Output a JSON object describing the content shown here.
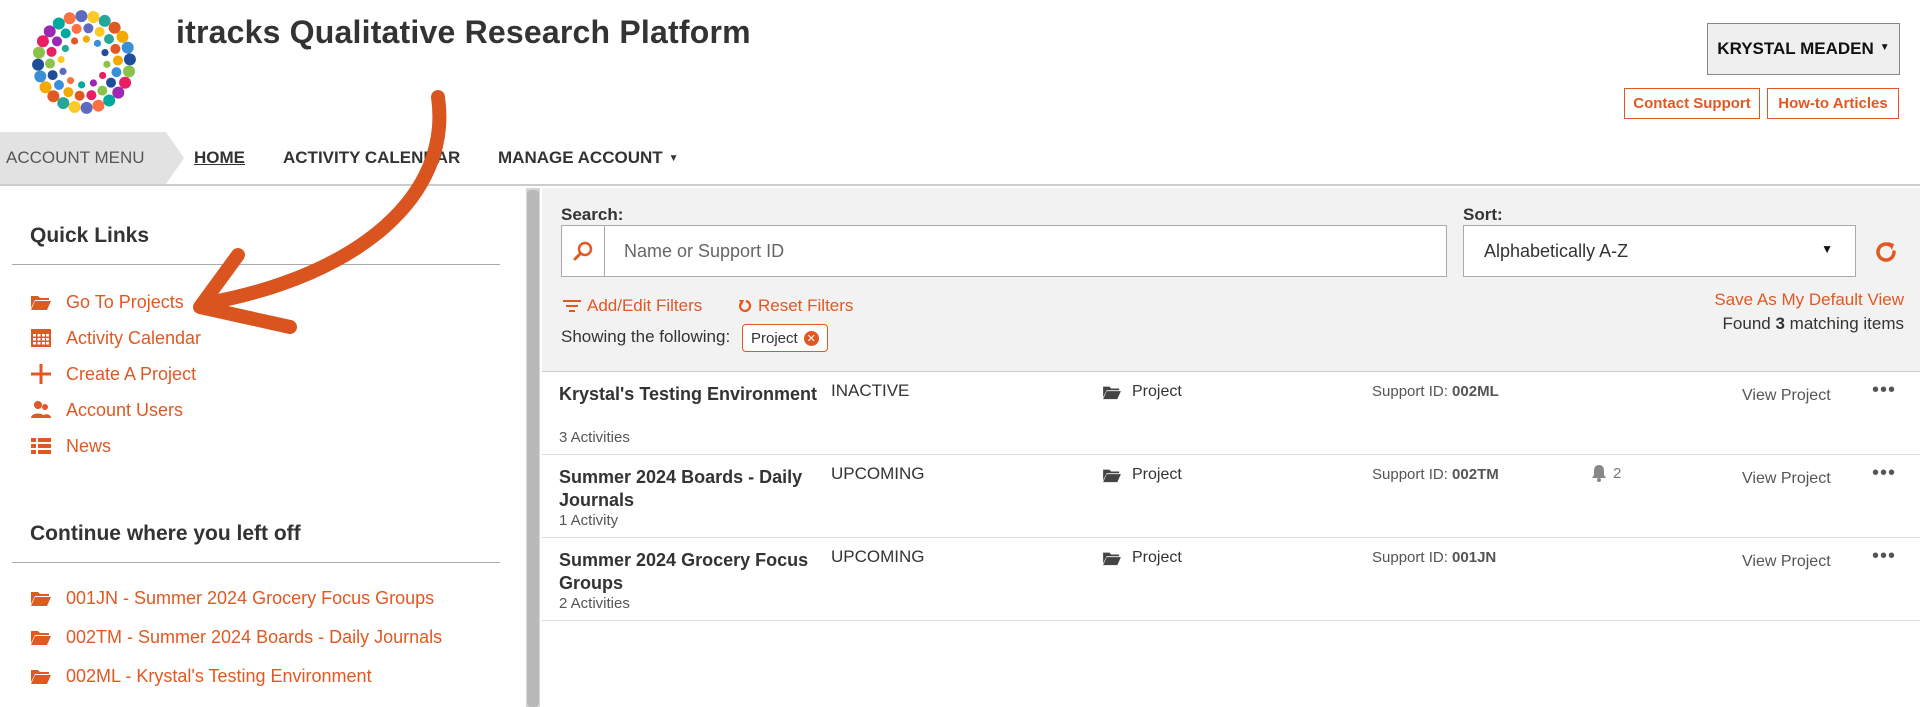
{
  "header": {
    "app_title": "itracks Qualitative Research Platform",
    "user_name": "KRYSTAL MEADEN",
    "contact_support": "Contact Support",
    "howto_articles": "How-to Articles"
  },
  "nav": {
    "account_menu": "ACCOUNT MENU",
    "home": "HOME",
    "activity_calendar": "ACTIVITY CALENDAR",
    "manage_account": "MANAGE ACCOUNT"
  },
  "sidebar": {
    "quick_links_title": "Quick Links",
    "quick_links": [
      {
        "label": "Go To Projects",
        "icon": "folder-icon"
      },
      {
        "label": "Activity Calendar",
        "icon": "calendar-icon"
      },
      {
        "label": "Create A Project",
        "icon": "plus-icon"
      },
      {
        "label": "Account Users",
        "icon": "users-icon"
      },
      {
        "label": "News",
        "icon": "list-icon"
      }
    ],
    "continue_title": "Continue where you left off",
    "recent": [
      {
        "label": "001JN - Summer 2024 Grocery Focus Groups"
      },
      {
        "label": "002TM - Summer 2024 Boards - Daily Journals"
      },
      {
        "label": "002ML - Krystal's Testing Environment"
      }
    ]
  },
  "filters": {
    "search_label": "Search:",
    "search_placeholder": "Name or Support ID",
    "sort_label": "Sort:",
    "sort_value": "Alphabetically A-Z",
    "add_edit_filters": "Add/Edit Filters",
    "reset_filters": "Reset Filters",
    "showing_label": "Showing the following:",
    "active_chip": "Project",
    "save_default": "Save As My Default View",
    "found_prefix": "Found",
    "found_count": "3",
    "found_suffix": "matching items"
  },
  "projects": [
    {
      "name": "Krystal's Testing Environment",
      "activities": "3 Activities",
      "status": "INACTIVE",
      "type": "Project",
      "support_label": "Support ID:",
      "support_id": "002ML",
      "notifications": "",
      "view": "View Project",
      "more": "•••"
    },
    {
      "name": "Summer 2024 Boards - Daily Journals",
      "activities": "1 Activity",
      "status": "UPCOMING",
      "type": "Project",
      "support_label": "Support ID:",
      "support_id": "002TM",
      "notifications": "2",
      "view": "View Project",
      "more": "•••"
    },
    {
      "name": "Summer 2024 Grocery Focus Groups",
      "activities": "2 Activities",
      "status": "UPCOMING",
      "type": "Project",
      "support_label": "Support ID:",
      "support_id": "001JN",
      "notifications": "",
      "view": "View Project",
      "more": "•••"
    }
  ],
  "colors": {
    "accent": "#e25822",
    "annotation_arrow": "#d9541e",
    "nav_bg": "#e2e2e2",
    "filter_bg": "#f2f2f2"
  }
}
